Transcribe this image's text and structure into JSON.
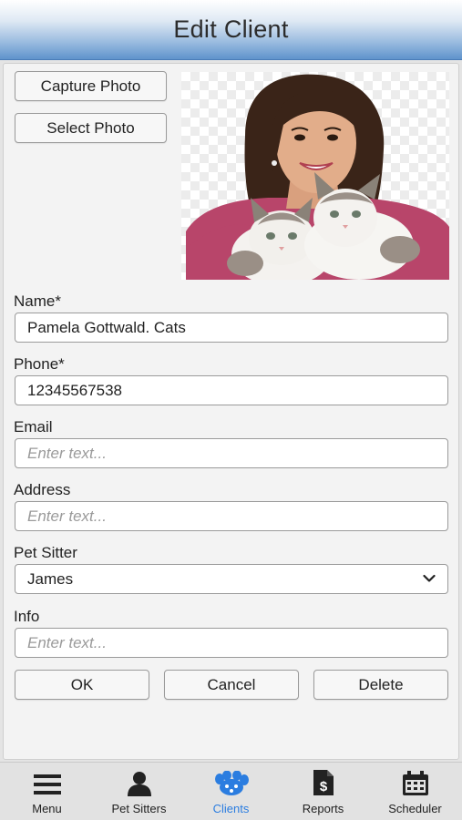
{
  "header": {
    "title": "Edit Client"
  },
  "photo_section": {
    "capture_label": "Capture Photo",
    "select_label": "Select Photo"
  },
  "form": {
    "name": {
      "label": "Name*",
      "value": "Pamela Gottwald. Cats"
    },
    "phone": {
      "label": "Phone*",
      "value": "12345567538"
    },
    "email": {
      "label": "Email",
      "placeholder": "Enter text..."
    },
    "address": {
      "label": "Address",
      "placeholder": "Enter text..."
    },
    "pet_sitter": {
      "label": "Pet Sitter",
      "selected": "James"
    },
    "info": {
      "label": "Info",
      "placeholder": "Enter text..."
    }
  },
  "actions": {
    "ok": "OK",
    "cancel": "Cancel",
    "delete": "Delete"
  },
  "tabbar": {
    "items": [
      {
        "label": "Menu",
        "icon": "menu-icon"
      },
      {
        "label": "Pet Sitters",
        "icon": "person-icon"
      },
      {
        "label": "Clients",
        "icon": "paw-icon",
        "active": true
      },
      {
        "label": "Reports",
        "icon": "report-dollar-icon"
      },
      {
        "label": "Scheduler",
        "icon": "calendar-icon"
      }
    ],
    "active_color": "#2b7de0"
  }
}
